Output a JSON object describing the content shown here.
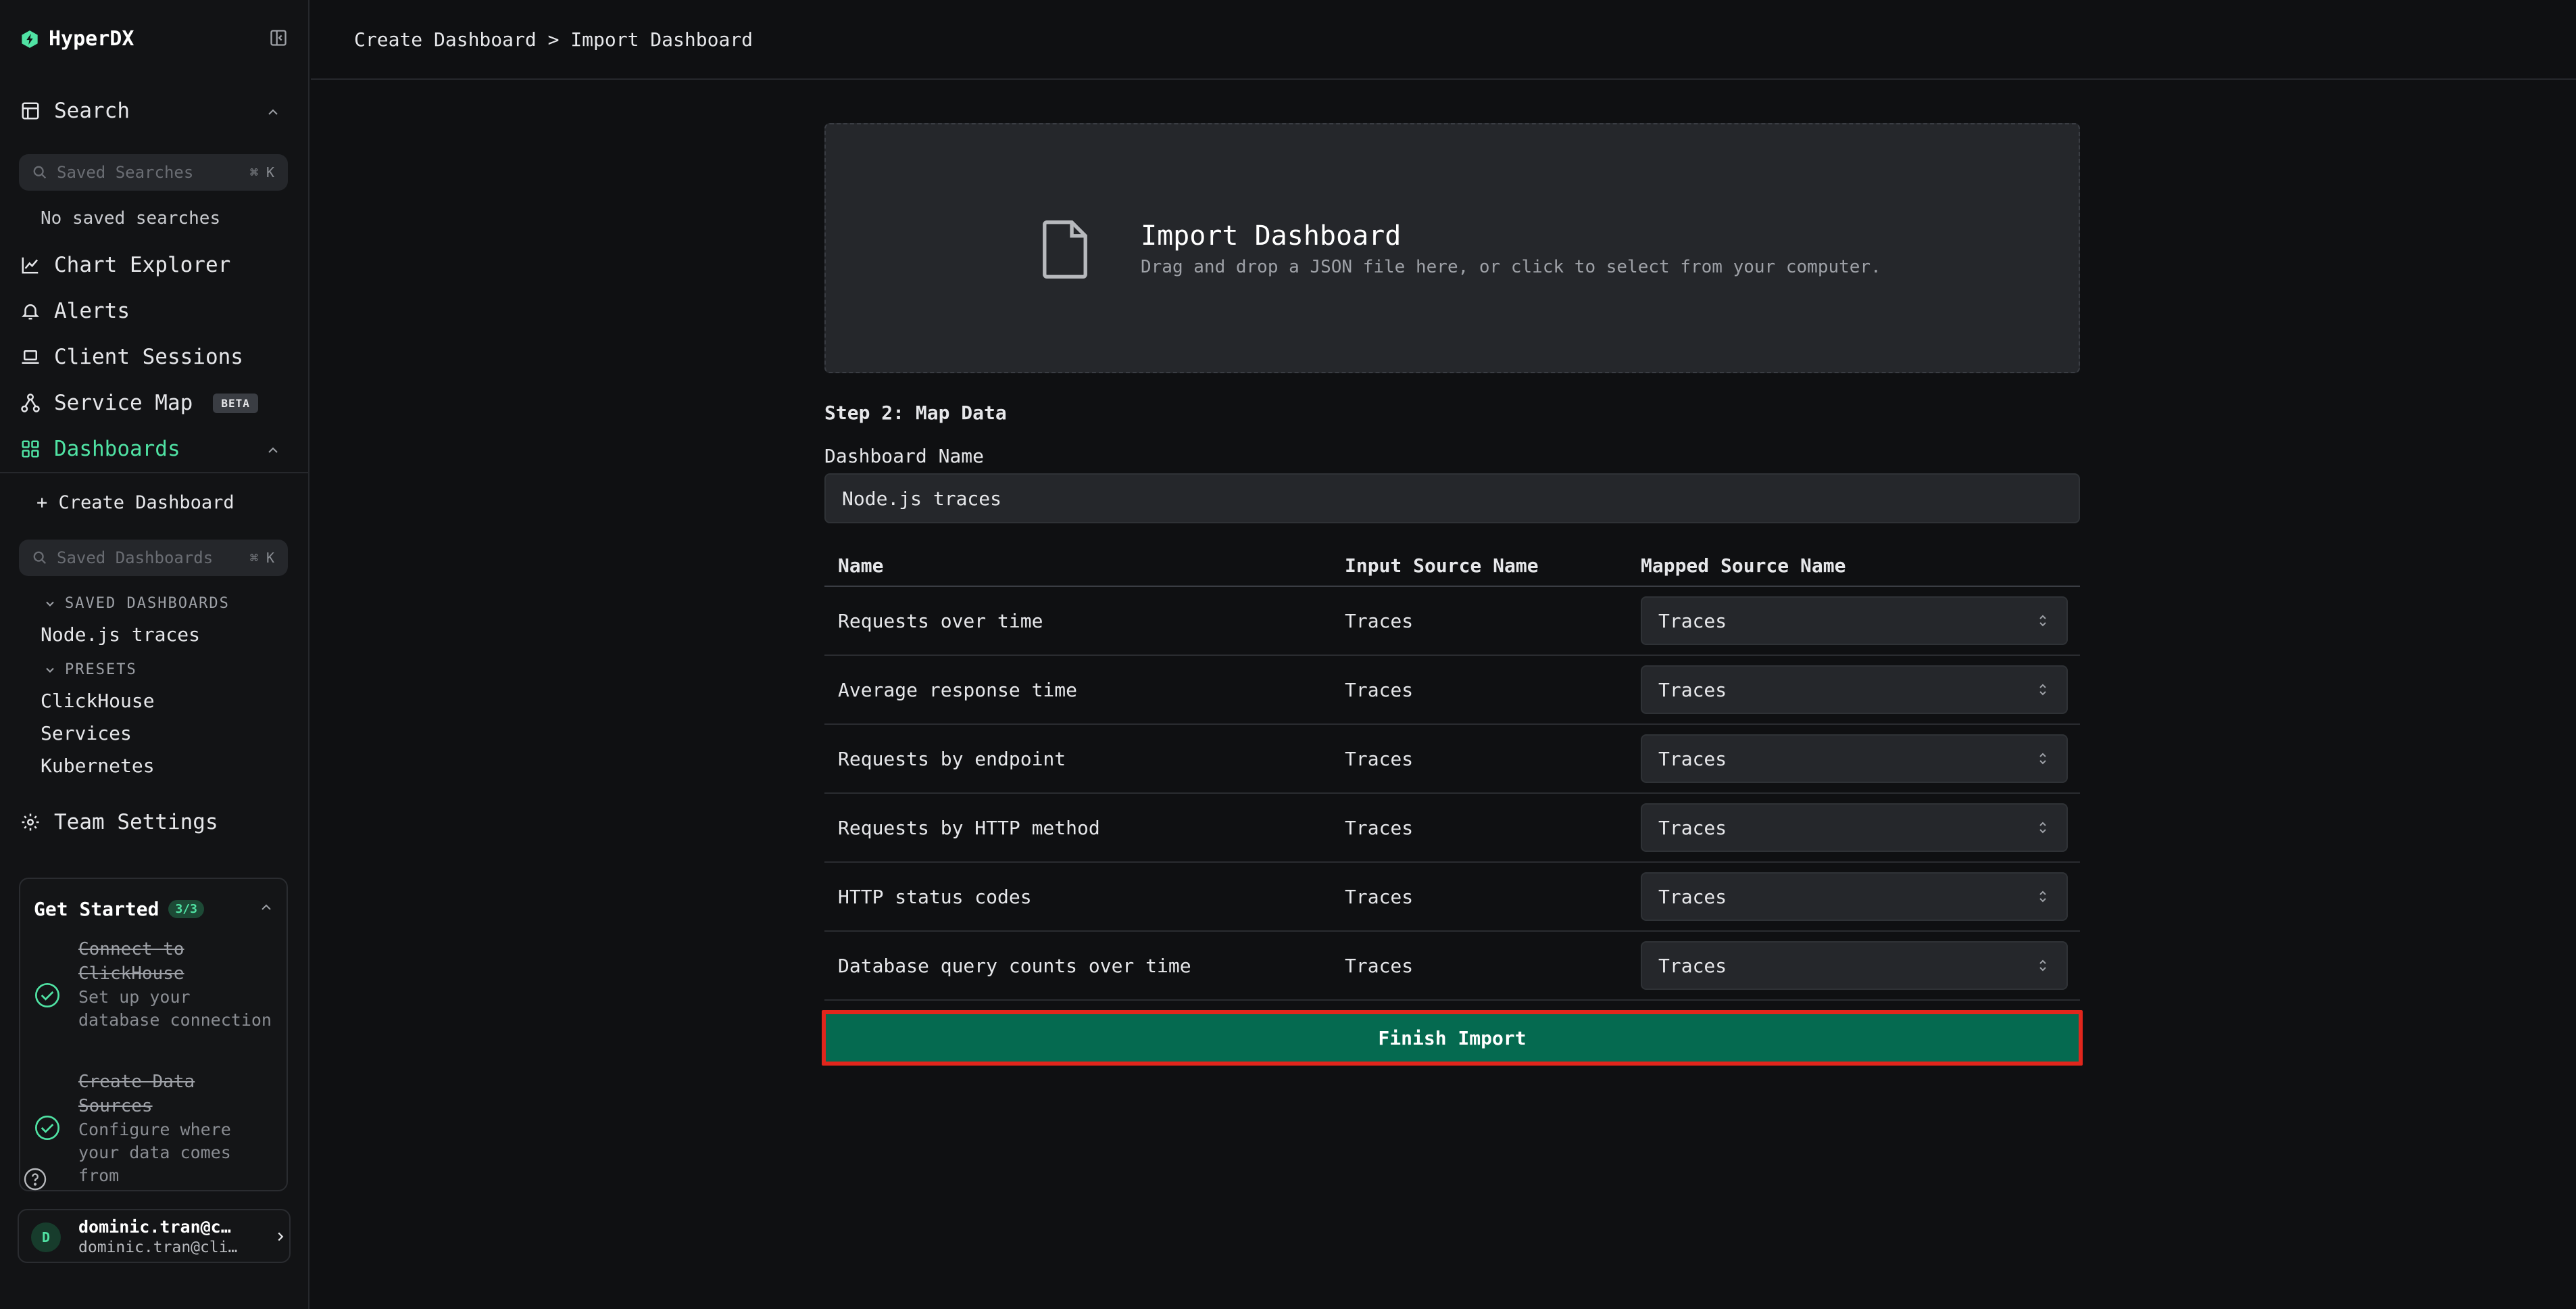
{
  "app": {
    "name": "HyperDX"
  },
  "sidebar": {
    "search": {
      "label": "Search",
      "placeholder": "Saved Searches",
      "shortcut": "⌘ K",
      "empty": "No saved searches"
    },
    "nav": {
      "chart_explorer": "Chart Explorer",
      "alerts": "Alerts",
      "client_sessions": "Client Sessions",
      "service_map": "Service Map",
      "service_map_badge": "BETA",
      "dashboards": "Dashboards",
      "team_settings": "Team Settings"
    },
    "dashboards": {
      "create": "+ Create Dashboard",
      "placeholder": "Saved Dashboards",
      "shortcut": "⌘ K",
      "saved_section": "SAVED DASHBOARDS",
      "saved": [
        "Node.js traces"
      ],
      "presets_section": "PRESETS",
      "presets": [
        "ClickHouse",
        "Services",
        "Kubernetes"
      ]
    },
    "get_started": {
      "title": "Get Started",
      "progress": "3/3",
      "steps": [
        {
          "title": "Connect to ClickHouse",
          "desc": "Set up your database connection"
        },
        {
          "title": "Create Data Sources",
          "desc": "Configure where your data comes from"
        }
      ]
    },
    "user": {
      "initial": "D",
      "name": "dominic.tran@c…",
      "email": "dominic.tran@cli…"
    }
  },
  "header": {
    "breadcrumb": "Create Dashboard > Import Dashboard"
  },
  "import": {
    "title": "Import Dashboard",
    "subtitle": "Drag and drop a JSON file here, or click to select from your computer."
  },
  "form": {
    "step": "Step 2: Map Data",
    "name_label": "Dashboard Name",
    "name_value": "Node.js traces"
  },
  "table": {
    "headers": [
      "Name",
      "Input Source Name",
      "Mapped Source Name"
    ],
    "rows": [
      {
        "name": "Requests over time",
        "input": "Traces",
        "mapped": "Traces"
      },
      {
        "name": "Average response time",
        "input": "Traces",
        "mapped": "Traces"
      },
      {
        "name": "Requests by endpoint",
        "input": "Traces",
        "mapped": "Traces"
      },
      {
        "name": "Requests by HTTP method",
        "input": "Traces",
        "mapped": "Traces"
      },
      {
        "name": "HTTP status codes",
        "input": "Traces",
        "mapped": "Traces"
      },
      {
        "name": "Database query counts over time",
        "input": "Traces",
        "mapped": "Traces"
      }
    ]
  },
  "actions": {
    "finish": "Finish Import"
  },
  "colors": {
    "accent": "#50e3a4",
    "primary_button": "#056a50",
    "highlight": "#e1261c"
  }
}
